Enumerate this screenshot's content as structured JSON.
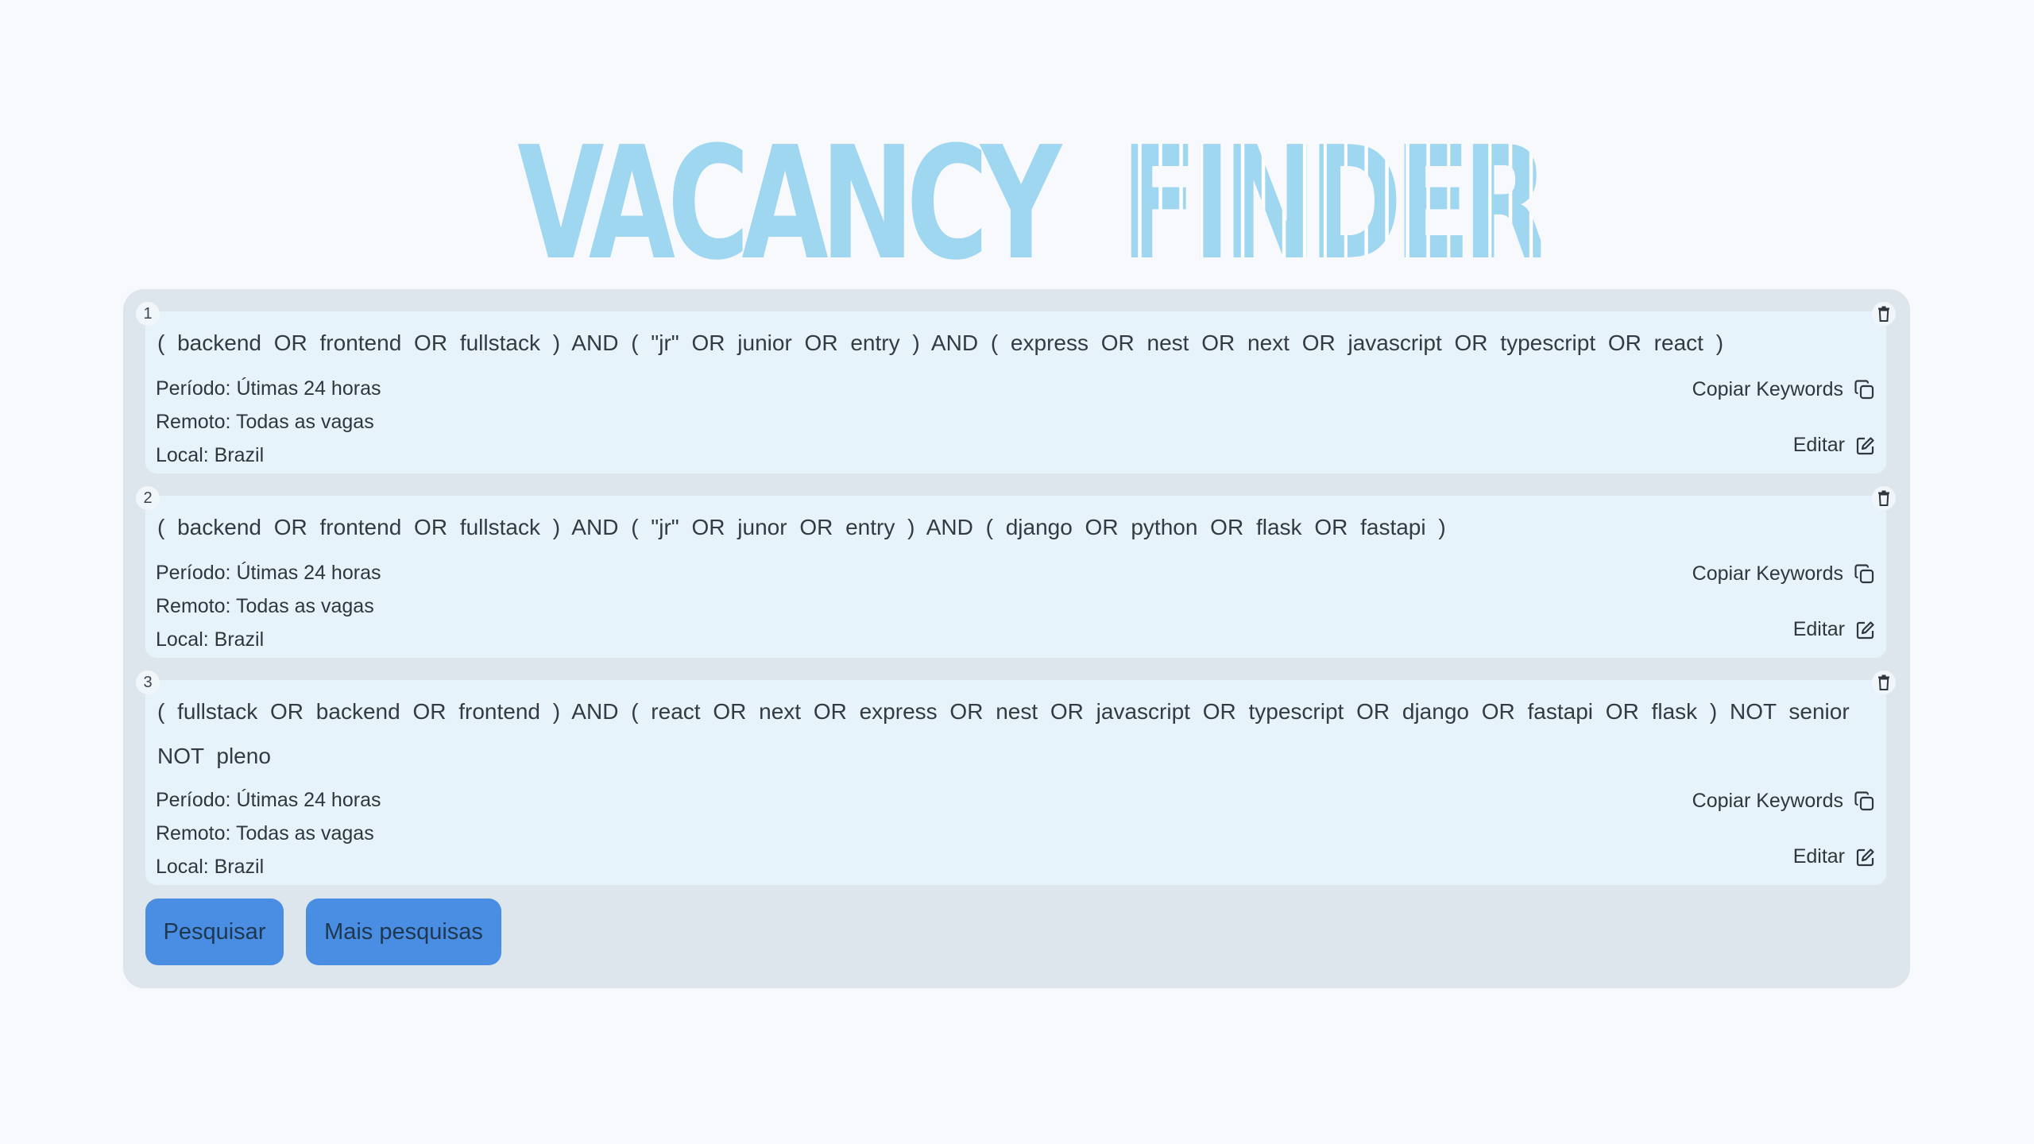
{
  "logo": {
    "part1": "VACANCY",
    "part2": "FINDER"
  },
  "searches": [
    {
      "index": "1",
      "query": "( backend OR frontend OR fullstack ) AND ( \"jr\" OR junior OR entry ) AND ( express OR nest OR next OR javascript OR typescript OR react )",
      "periodo": "Período: Útimas 24 horas",
      "remoto": "Remoto: Todas as vagas",
      "local": "Local: Brazil"
    },
    {
      "index": "2",
      "query": "( backend OR frontend OR fullstack ) AND ( \"jr\" OR junor OR entry ) AND ( django OR python OR flask OR fastapi )",
      "periodo": "Período: Útimas 24 horas",
      "remoto": "Remoto: Todas as vagas",
      "local": "Local: Brazil"
    },
    {
      "index": "3",
      "query": "( fullstack OR backend OR frontend ) AND ( react OR next OR express OR nest OR javascript OR typescript OR django OR fastapi OR flask ) NOT senior NOT pleno",
      "periodo": "Período: Útimas 24 horas",
      "remoto": "Remoto: Todas as vagas",
      "local": "Local: Brazil"
    }
  ],
  "actions": {
    "copy_label": "Copiar Keywords",
    "edit_label": "Editar",
    "copy_icon": "copy-icon",
    "edit_icon": "edit-icon",
    "delete_icon": "trash-icon"
  },
  "buttons": {
    "search_label": "Pesquisar",
    "more_label": "Mais pesquisas"
  },
  "colors": {
    "background": "#f7f9fc",
    "panel": "#dee6ed",
    "card": "#e6f3fb",
    "logo": "#9fd6f0",
    "button": "#4a8ee3"
  }
}
